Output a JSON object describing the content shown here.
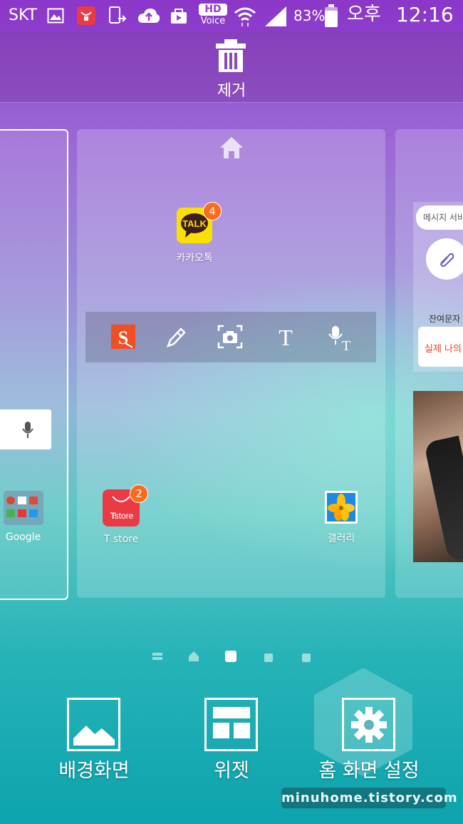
{
  "status_bar": {
    "carrier": "SKT",
    "hd_label": "HD",
    "voice_label": "Voice",
    "battery_percent": "83%",
    "ampm": "오후",
    "time": "12:16"
  },
  "remove_zone": {
    "label": "제거"
  },
  "home_panel": {
    "apps": [
      {
        "label": "카카오톡",
        "badge": "4",
        "icon_text": "TALK",
        "icon": "kakaotalk-icon"
      },
      {
        "label": "T store",
        "badge": "2",
        "icon_text": "store",
        "icon": "tstore-icon"
      },
      {
        "label": "갤러리",
        "icon": "gallery-icon"
      }
    ],
    "pen_toolbar": {
      "tools": [
        {
          "name": "s-note-icon",
          "text": "S"
        },
        {
          "name": "pen-icon"
        },
        {
          "name": "screen-capture-icon"
        },
        {
          "name": "text-tool-icon",
          "text": "T"
        },
        {
          "name": "voice-to-text-icon",
          "text": "T"
        }
      ]
    }
  },
  "left_panel": {
    "folder_label": "Google"
  },
  "right_panel": {
    "message_placeholder": "메시지 서비",
    "remain_label": "잔여문자",
    "message_text": "실제 나의"
  },
  "bottom_actions": [
    {
      "label": "배경화면",
      "icon": "wallpaper-icon"
    },
    {
      "label": "위젯",
      "icon": "widgets-icon"
    },
    {
      "label": "홈 화면 설정",
      "icon": "settings-gear-icon"
    }
  ],
  "watermark": "minuhome.tistory.com",
  "colors": {
    "badge": "#ff6a1a",
    "kakao_yellow": "#f9e000",
    "tstore_red": "#ea3b45",
    "snote_orange": "#f04e23"
  }
}
